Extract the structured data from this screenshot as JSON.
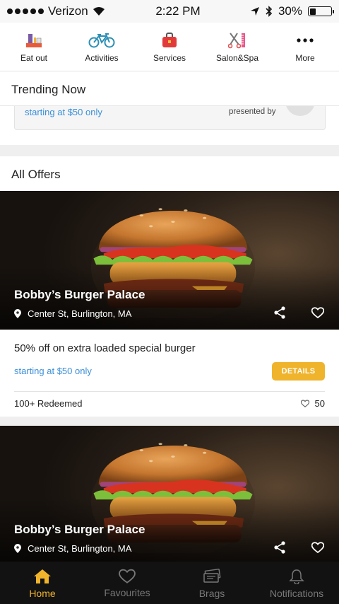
{
  "status": {
    "carrier": "Verizon",
    "time": "2:22 PM",
    "battery": "30%",
    "battery_level": 0.3
  },
  "categories": [
    {
      "label": "Eat out",
      "icon": "eat-out-icon"
    },
    {
      "label": "Activities",
      "icon": "bicycle-icon"
    },
    {
      "label": "Services",
      "icon": "toolbox-icon"
    },
    {
      "label": "Salon&Spa",
      "icon": "salon-icon"
    },
    {
      "label": "More",
      "icon": "more-icon"
    }
  ],
  "trending": {
    "title": "Trending Now",
    "price_text": "starting at $50 only",
    "presented_by": "presented by"
  },
  "offers": {
    "title": "All Offers",
    "items": [
      {
        "venue": "Bobby’s Burger Palace",
        "location": "Center St, Burlington, MA",
        "title": "50% off on extra loaded special burger",
        "price_text": "starting at $50 only",
        "button": "DETAILS",
        "redeemed": "100+ Redeemed",
        "likes": "50"
      },
      {
        "venue": "Bobby’s Burger Palace",
        "location": "Center St, Burlington, MA"
      }
    ]
  },
  "tabs": [
    {
      "label": "Home",
      "icon": "home-icon",
      "active": true
    },
    {
      "label": "Favourites",
      "icon": "heart-icon",
      "active": false
    },
    {
      "label": "Brags",
      "icon": "tickets-icon",
      "active": false
    },
    {
      "label": "Notifications",
      "icon": "bell-icon",
      "active": false
    }
  ],
  "colors": {
    "accent": "#efb32c",
    "link": "#3a8fd8",
    "tabbar": "#121212"
  }
}
